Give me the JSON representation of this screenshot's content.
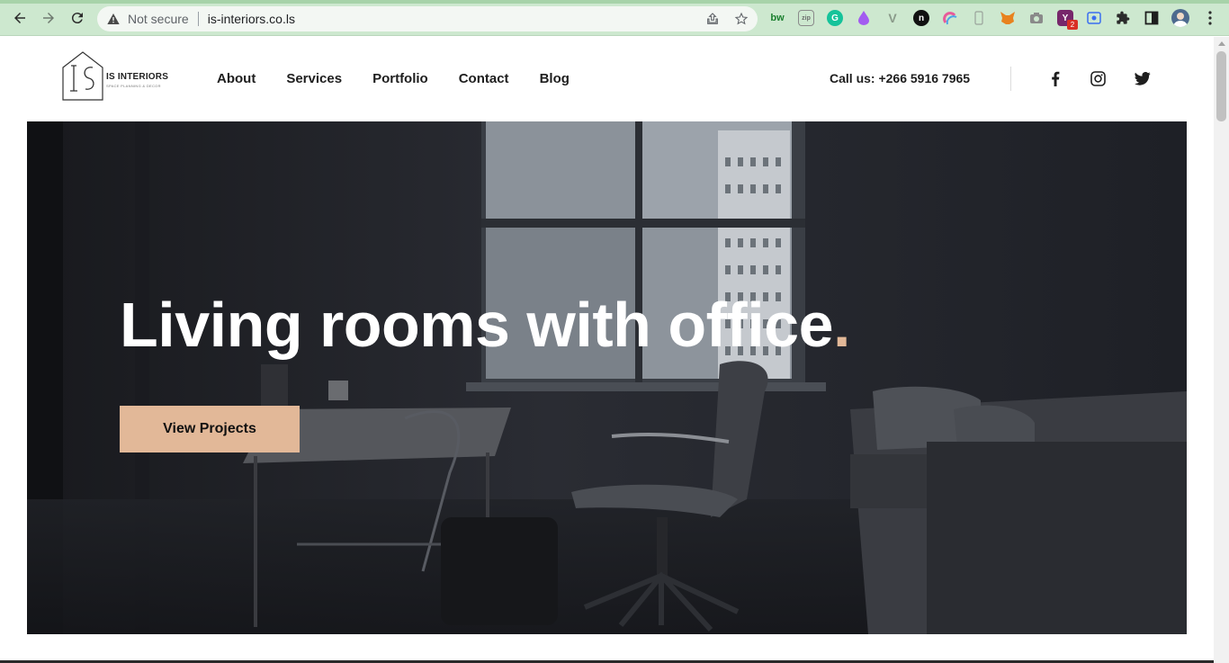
{
  "browser": {
    "security_label": "Not secure",
    "url": "is-interiors.co.ls",
    "tab_count_badge": "2",
    "extensions": [
      "bw-icon",
      "zip-icon",
      "grammarly-icon",
      "drop-icon",
      "vee-icon",
      "n-icon",
      "magnet-icon",
      "phone-icon",
      "fox-icon",
      "camera-icon",
      "yoast-icon",
      "record-icon",
      "puzzle-icon",
      "sidepanel-icon",
      "profile-avatar",
      "more-menu-icon"
    ]
  },
  "site": {
    "brand": "IS INTERIORS",
    "tagline": "SPACE PLANNING & DECOR",
    "nav": [
      "About",
      "Services",
      "Portfolio",
      "Contact",
      "Blog"
    ],
    "callus": "Call us: +266 5916 7965",
    "social": [
      "facebook-icon",
      "instagram-icon",
      "twitter-icon"
    ]
  },
  "hero": {
    "title": "Living rooms with office",
    "title_dot": ".",
    "button": "View Projects"
  },
  "colors": {
    "accent": "#e2b898",
    "chrome_bg": "#cde8cf",
    "hero_bg": "#1c1d22"
  }
}
